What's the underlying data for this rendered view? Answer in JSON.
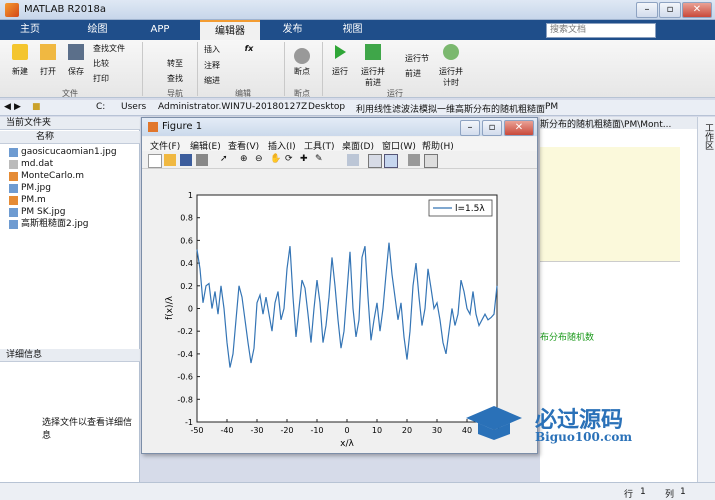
{
  "window": {
    "title": "MATLAB R2018a"
  },
  "tabs": [
    "主页",
    "绘图",
    "APP",
    "编辑器",
    "发布",
    "视图"
  ],
  "search": {
    "placeholder": "搜索文档"
  },
  "ribbon": {
    "file": {
      "new": "新建",
      "open": "打开",
      "save": "保存",
      "find_files": "查找文件",
      "compare": "比较",
      "print": "打印",
      "label": "文件"
    },
    "nav": {
      "goto": "转至",
      "find": "查找",
      "label": "导航"
    },
    "edit": {
      "insert": "插入",
      "comment": "注释",
      "indent": "缩进",
      "fx": "fx",
      "label": "编辑"
    },
    "breakpoints": {
      "label_btn": "断点",
      "label": "断点"
    },
    "run": {
      "run": "运行",
      "run_advance": "运行并\n前进",
      "run_section": "运行节",
      "advance": "前进",
      "run_time": "运行并\n计时",
      "label": "运行"
    }
  },
  "address": {
    "parts": [
      "C:",
      "Users",
      "Administrator.WIN7U-20180127Z",
      "Desktop",
      "利用线性滤波法模拟一维高斯分布的随机粗糙面",
      "PM"
    ],
    "right_path": "斯分布的随机粗糙面\\PM\\Mont..."
  },
  "left_panel": {
    "header": "当前文件夹",
    "col_name": "名称",
    "files": [
      "gaosicucaomian1.jpg",
      "md.dat",
      "MonteCarlo.m",
      "PM.jpg",
      "PM.m",
      "PM SK.jpg",
      "高斯粗糙面2.jpg"
    ],
    "details_header": "详细信息",
    "details_text": "选择文件以查看详细信息"
  },
  "right_side": {
    "side_label": "工作区",
    "snippet": "布分布随机数"
  },
  "figure": {
    "title": "Figure 1",
    "menu": [
      "文件(F)",
      "编辑(E)",
      "查看(V)",
      "插入(I)",
      "工具(T)",
      "桌面(D)",
      "窗口(W)",
      "帮助(H)"
    ]
  },
  "chart_data": {
    "type": "line",
    "xlabel": "x/λ",
    "ylabel": "f(x)/λ",
    "xlim": [
      -50,
      50
    ],
    "ylim": [
      -1,
      1
    ],
    "xticks": [
      -50,
      -40,
      -30,
      -20,
      -10,
      0,
      10,
      20,
      30,
      40,
      50
    ],
    "yticks": [
      1,
      0.8,
      0.6,
      0.4,
      0.2,
      0,
      -0.2,
      -0.4,
      -0.6,
      -0.8,
      -1
    ],
    "grid": false,
    "legend_position": "top-right",
    "series": [
      {
        "name": "l=1.5λ",
        "color": "#3575b5",
        "x": [
          -50,
          -49,
          -48,
          -47,
          -46,
          -45,
          -44,
          -43,
          -42,
          -41,
          -40,
          -39,
          -38,
          -37,
          -36,
          -35,
          -34,
          -33,
          -32,
          -31,
          -30,
          -29,
          -28,
          -27,
          -26,
          -25,
          -24,
          -23,
          -22,
          -21,
          -20,
          -19,
          -18,
          -17,
          -16,
          -15,
          -14,
          -13,
          -12,
          -11,
          -10,
          -9,
          -8,
          -7,
          -6,
          -5,
          -4,
          -3,
          -2,
          -1,
          0,
          1,
          2,
          3,
          4,
          5,
          6,
          7,
          8,
          9,
          10,
          11,
          12,
          13,
          14,
          15,
          16,
          17,
          18,
          19,
          20,
          21,
          22,
          23,
          24,
          25,
          26,
          27,
          28,
          29,
          30,
          31,
          32,
          33,
          34,
          35,
          36,
          37,
          38,
          39,
          40,
          41,
          42,
          43,
          44,
          45,
          46,
          47,
          48,
          49,
          50
        ],
        "y": [
          0.52,
          0.35,
          0.05,
          0.2,
          0.22,
          0.0,
          0.15,
          -0.05,
          0.2,
          0.0,
          -0.3,
          -0.52,
          -0.4,
          -0.1,
          0.2,
          0.1,
          -0.1,
          -0.3,
          -0.48,
          -0.35,
          0.05,
          0.12,
          -0.05,
          0.1,
          -0.05,
          -0.2,
          0.05,
          0.15,
          -0.1,
          0.0,
          0.35,
          0.55,
          0.1,
          -0.25,
          0.0,
          0.25,
          0.18,
          -0.05,
          -0.3,
          0.0,
          0.25,
          0.05,
          -0.3,
          -0.15,
          0.1,
          0.45,
          0.2,
          -0.1,
          -0.35,
          -0.2,
          0.15,
          0.5,
          0.0,
          -0.25,
          -0.1,
          0.45,
          0.55,
          0.1,
          -0.28,
          -0.1,
          0.05,
          -0.2,
          0.0,
          0.3,
          0.58,
          0.3,
          0.1,
          -0.1,
          0.05,
          -0.25,
          -0.45,
          -0.2,
          0.2,
          0.4,
          0.1,
          -0.15,
          0.0,
          0.35,
          0.18,
          0.0,
          0.05,
          -0.1,
          -0.3,
          -0.4,
          -0.2,
          0.0,
          -0.15,
          -0.05,
          0.25,
          0.15,
          0.0,
          -0.05,
          0.15,
          -0.05,
          -0.15,
          -0.1,
          -0.05,
          -0.1,
          -0.08,
          -0.05,
          0.2
        ]
      }
    ]
  },
  "status": {
    "row_label": "行",
    "row_value": "1",
    "col_label": "列",
    "col_value": "1"
  },
  "watermark": {
    "text1": "必过源码",
    "text2": "Biguo100.com"
  }
}
